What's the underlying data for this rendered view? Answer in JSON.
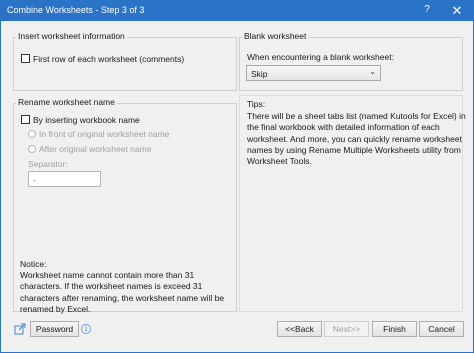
{
  "window": {
    "title": "Combine Worksheets - Step 3 of 3",
    "help_label": "?",
    "close_label": "✕",
    "accent_color": "#2b73c7"
  },
  "insert_info": {
    "legend": "Insert worksheet information",
    "first_row_label": "First row of each worksheet (comments)",
    "first_row_checked": false
  },
  "blank_worksheet": {
    "legend": "Blank worksheet",
    "prompt": "When encountering a blank worksheet:",
    "selected": "Skip"
  },
  "rename": {
    "legend": "Rename worksheet name",
    "by_inserting_label": "By inserting workbook name",
    "by_inserting_checked": false,
    "option_front": "In front of original worksheet name",
    "option_after": "After original worksheet name",
    "separator_label": "Separator:",
    "separator_value": "-"
  },
  "tips": {
    "heading": "Tips:",
    "text": "There will be a sheet tabs list (named Kutools for Excel) in the final workbook with detailed information of each worksheet. And more, you can quickly rename worksheet names by using Rename Multiple Worksheets utility from Worksheet Tools."
  },
  "notice": {
    "heading": "Notice:",
    "text": "Worksheet name cannot contain more than 31 characters. If the worksheet names is exceed 31 characters after renaming, the worksheet name will be renamed by Excel."
  },
  "footer": {
    "share_icon": "share-icon",
    "password_label": "Password",
    "info_icon": "info-icon",
    "info_glyph": "i",
    "back_label": "<<Back",
    "next_label": "Next>>",
    "finish_label": "Finish",
    "cancel_label": "Cancel"
  }
}
